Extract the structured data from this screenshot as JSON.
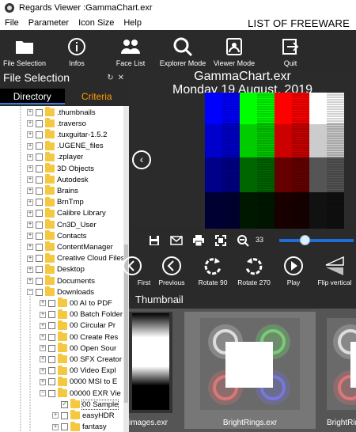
{
  "window": {
    "title": "Regards Viewer :GammaChart.exr"
  },
  "menu": {
    "items": [
      "File",
      "Parameter",
      "Icon Size",
      "Help"
    ],
    "brand": "LIST OF FREEWARE"
  },
  "toolbar": {
    "file_selection": "File Selection",
    "infos": "Infos",
    "face_list": "Face List",
    "explorer_mode": "Explorer Mode",
    "viewer_mode": "Viewer Mode",
    "quit": "Quit"
  },
  "left_panel": {
    "title": "File Selection",
    "tab_directory": "Directory",
    "tab_criteria": "Criteria",
    "tree": [
      ".thumbnails",
      ".traverso",
      ".tuxguitar-1.5.2",
      ".UGENE_files",
      ".zplayer",
      "3D Objects",
      "Autodesk",
      "Brains",
      "BrnTmp",
      "Calibre Library",
      "Cn3D_User",
      "Contacts",
      "ContentManager",
      "Creative Cloud Files",
      "Desktop",
      "Documents",
      "Downloads",
      "00 AI to PDF",
      "00 Batch Folder",
      "00 Circular Pr",
      "00 Create Res",
      "00 Open Sour",
      "00 SFX Creator",
      "00 Video Expl",
      "0000 MSI to E",
      "00000 EXR Vie",
      "00 Sample",
      "easyHDR",
      "fantasy"
    ]
  },
  "viewer": {
    "filename": "GammaChart.exr",
    "date": "Monday 19 August, 2019",
    "zoom": "33",
    "zoom_slider_fraction": 0.33
  },
  "actions": {
    "first": "First",
    "previous": "Previous",
    "rotate90": "Rotate 90",
    "rotate270": "Rotate 270",
    "play": "Play",
    "flip_vertical": "Flip vertical"
  },
  "thumbnails": {
    "header": "Thumbnail",
    "items": [
      "images.exr",
      "BrightRings.exr",
      "BrightRings"
    ]
  },
  "colors": {
    "panel_dark": "#2a2a2a",
    "accent_blue": "#1e6fd9",
    "tab_inactive": "#ff9900",
    "folder": "#f5c842"
  }
}
